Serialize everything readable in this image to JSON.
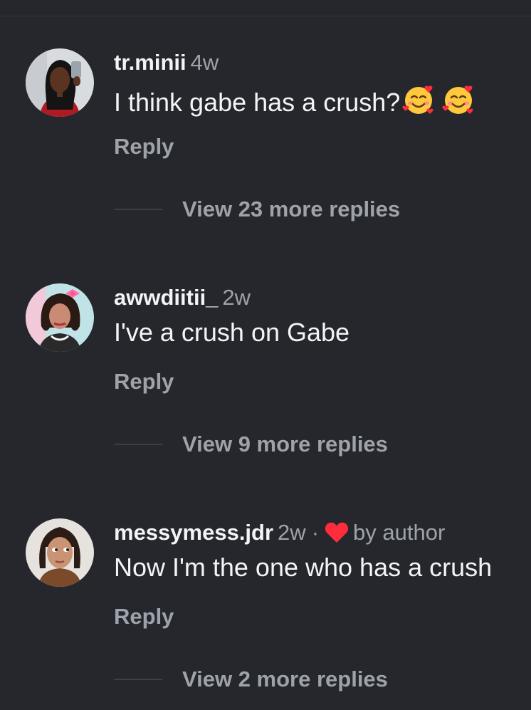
{
  "comments": [
    {
      "username": "tr.minii",
      "time": "4w",
      "text": "I think gabe has a crush?",
      "emojis": [
        "smiling-face-with-hearts",
        "smiling-face-with-hearts"
      ],
      "reply_label": "Reply",
      "view_more": "View 23 more replies"
    },
    {
      "username": "awwdiitii_",
      "time": "2w",
      "text": "I've a crush on Gabe",
      "reply_label": "Reply",
      "view_more": "View 9 more replies"
    },
    {
      "username": "messymess.jdr",
      "time": "2w",
      "separator": "·",
      "liked_by": "by author",
      "text": "Now I'm the one who has a crush",
      "reply_label": "Reply",
      "view_more": "View 2 more replies"
    }
  ],
  "colors": {
    "background": "#25272c",
    "primary_text": "#f3f4f6",
    "secondary_text": "#9ea3ab",
    "heart": "#ff2d3b"
  }
}
